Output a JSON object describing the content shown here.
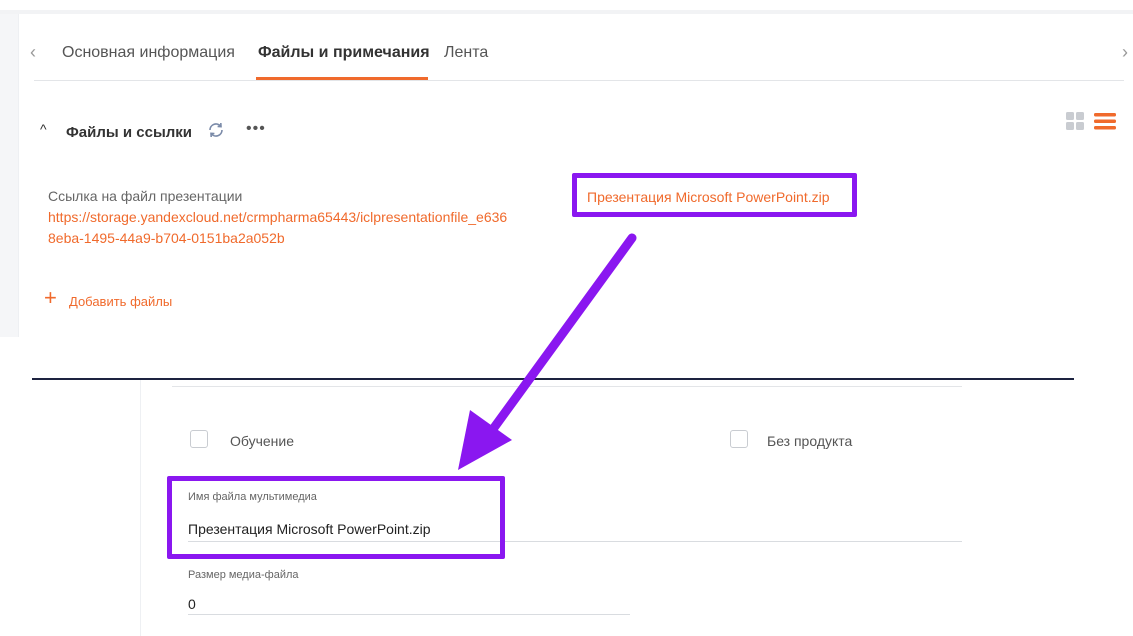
{
  "tabs": {
    "main": "Основная информация",
    "files": "Файлы и примечания",
    "feed": "Лента"
  },
  "icons": {
    "chevron_left": "‹",
    "chevron_right": "›",
    "section_caret": "^",
    "more": "•••",
    "add": "+"
  },
  "section": {
    "title": "Файлы и ссылки"
  },
  "link": {
    "label": "Ссылка на файл презентации",
    "url_line1": "https://storage.yandexcloud.net/crmpharma65443/iclpresentationfile_e636",
    "url_line2": "8eba-1495-44a9-b704-0151ba2a052b"
  },
  "attachment": {
    "name": "Презентация Microsoft PowerPoint.zip"
  },
  "add_files_label": "Добавить файлы",
  "form": {
    "training_label": "Обучение",
    "no_product_label": "Без продукта",
    "media_name_label": "Имя файла мультимедиа",
    "media_name_value": "Презентация Microsoft PowerPoint.zip",
    "media_size_label": "Размер медиа-файла",
    "media_size_value": "0"
  },
  "colors": {
    "accent": "#f06a2c",
    "highlight": "#8a17f0",
    "divider": "#1d2340"
  }
}
